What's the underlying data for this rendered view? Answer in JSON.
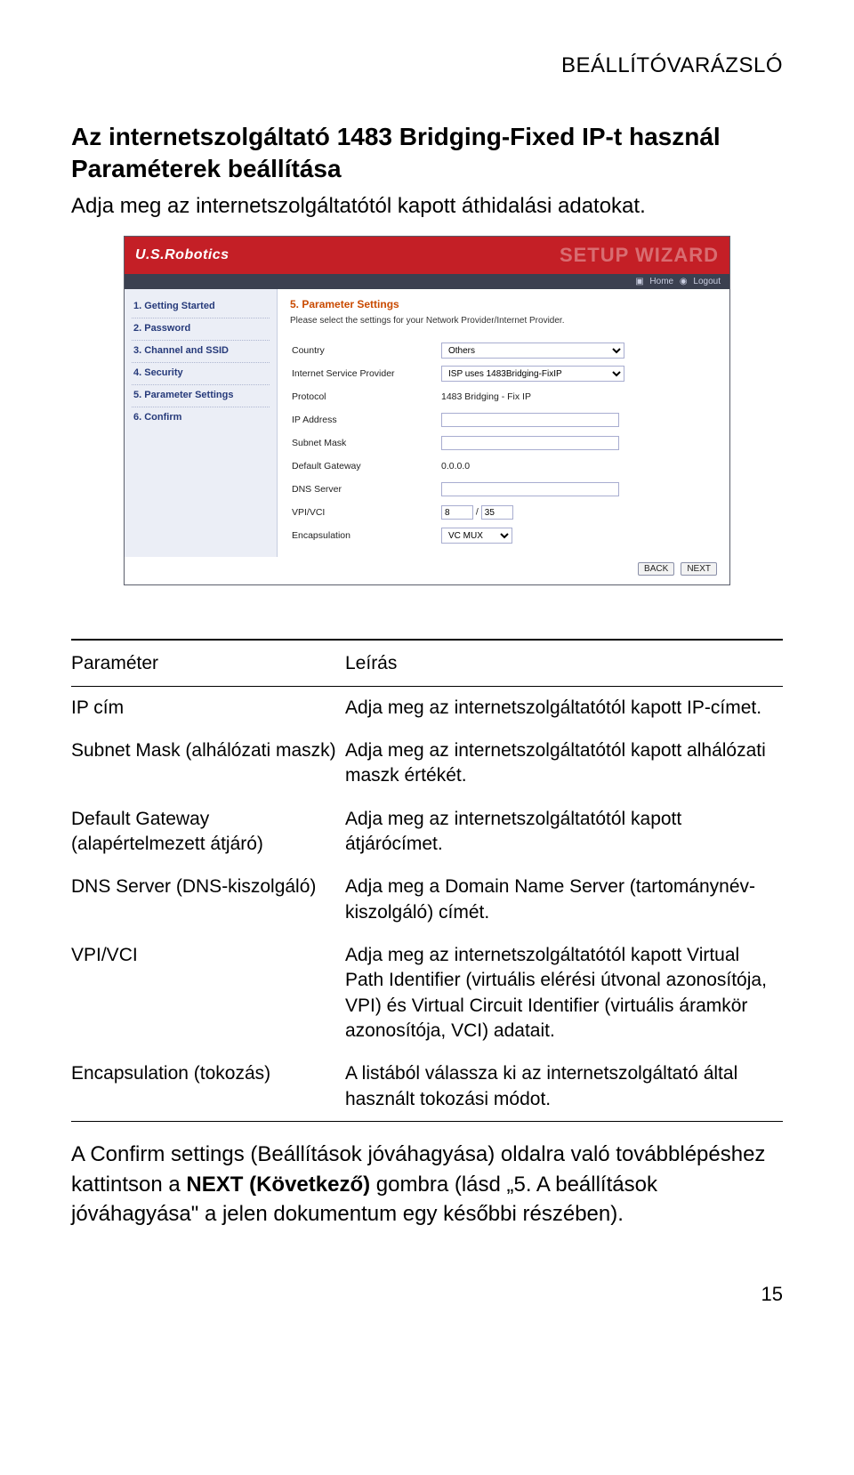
{
  "header": "BEÁLLÍTÓVARÁZSLÓ",
  "title": "Az internetszolgáltató 1483 Bridging-Fixed IP-t használ",
  "subtitle": "Paraméterek beállítása",
  "intro": "Adja meg az internetszolgáltatótól kapott áthidalási adatokat.",
  "shot": {
    "brand": "U.S.Robotics",
    "wizard": "SETUP WIZARD",
    "linkbar": {
      "home": "Home",
      "logout": "Logout"
    },
    "nav": [
      "1. Getting Started",
      "2. Password",
      "3. Channel and SSID",
      "4. Security",
      "5. Parameter Settings",
      "6. Confirm"
    ],
    "panel_title": "5. Parameter Settings",
    "panel_desc": "Please select the settings for your Network Provider/Internet Provider.",
    "rows": {
      "country_lbl": "Country",
      "country_val": "Others",
      "isp_lbl": "Internet Service Provider",
      "isp_val": "ISP uses 1483Bridging-FixIP",
      "proto_lbl": "Protocol",
      "proto_val": "1483 Bridging - Fix IP",
      "ip_lbl": "IP Address",
      "ip_val": "",
      "mask_lbl": "Subnet Mask",
      "mask_val": "",
      "gw_lbl": "Default Gateway",
      "gw_val": "0.0.0.0",
      "dns_lbl": "DNS Server",
      "dns_val": "",
      "vpi_lbl": "VPI/VCI",
      "vpi_val": "8",
      "vci_val": "35",
      "vpi_sep": "/",
      "enc_lbl": "Encapsulation",
      "enc_val": "VC MUX"
    },
    "back": "BACK",
    "next": "NEXT"
  },
  "table": {
    "head_param": "Paraméter",
    "head_desc": "Leírás",
    "rows": [
      {
        "p": "IP cím",
        "d": "Adja meg az internetszolgáltatótól kapott IP-címet."
      },
      {
        "p": "Subnet Mask (alhálózati maszk)",
        "d": "Adja meg az internetszolgáltatótól kapott alhálózati maszk értékét."
      },
      {
        "p": "Default Gateway (alapértelmezett átjáró)",
        "d": "Adja meg az internetszolgáltatótól kapott átjárócímet."
      },
      {
        "p": "DNS Server (DNS-kiszolgáló)",
        "d": "Adja meg a Domain Name Server (tartománynév-kiszolgáló) címét."
      },
      {
        "p": "VPI/VCI",
        "d": "Adja meg az internetszolgáltatótól kapott Virtual Path Identifier (virtuális elérési útvonal azonosítója, VPI) és Virtual Circuit Identifier (virtuális áramkör azonosítója, VCI) adatait."
      },
      {
        "p": "Encapsulation (tokozás)",
        "d": "A listából válassza ki az internetszolgáltató által használt tokozási módot."
      }
    ]
  },
  "after1": "A Confirm settings (Beállítások jóváhagyása) oldalra való továbblépéshez kattintson a ",
  "after_bold": "NEXT (Következő)",
  "after2": " gombra (lásd „5. A beállítások jóváhagyása\" a jelen dokumentum egy későbbi részében).",
  "page_num": "15"
}
